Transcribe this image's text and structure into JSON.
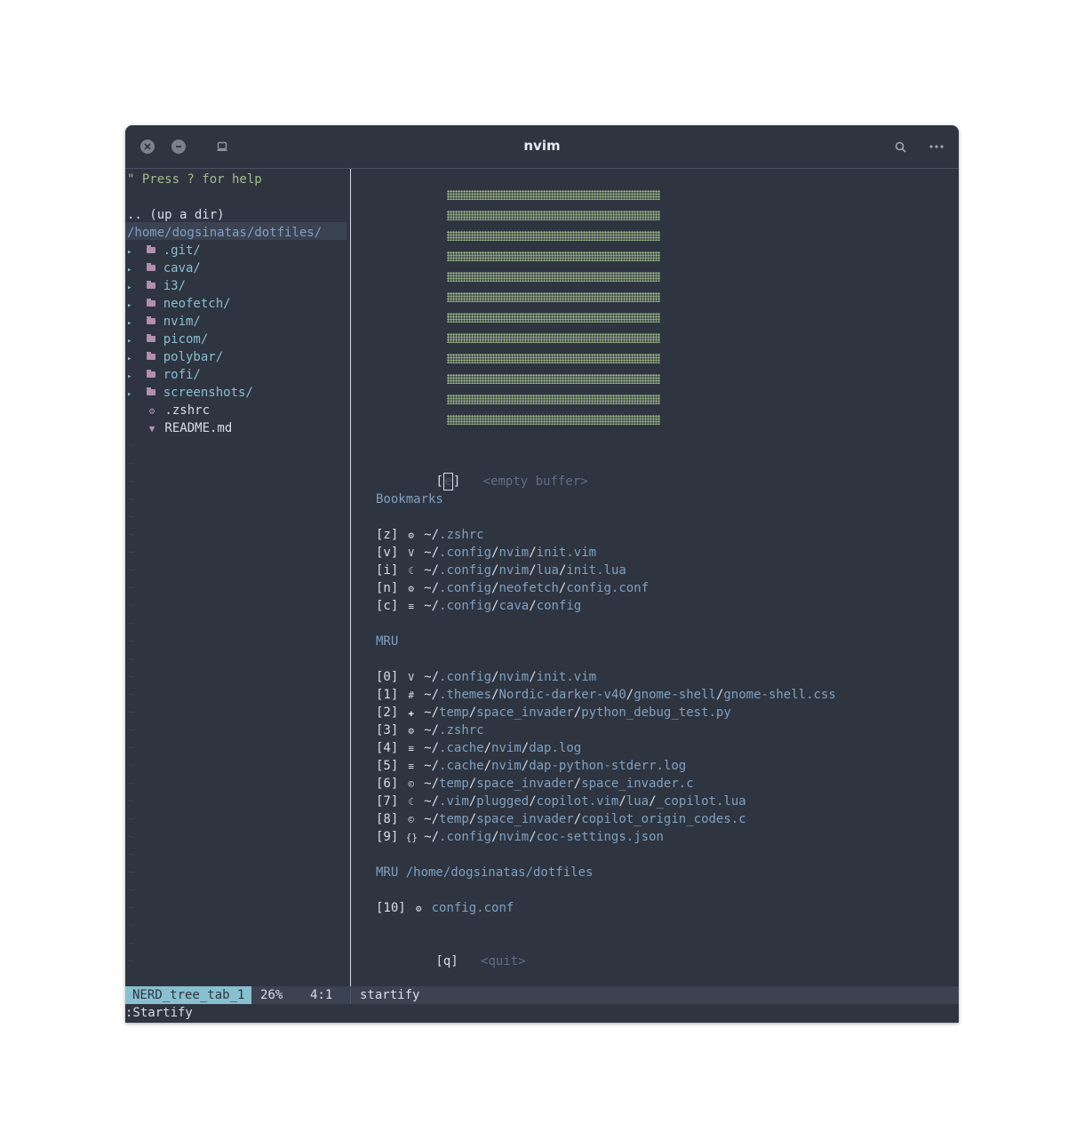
{
  "window": {
    "title": "nvim"
  },
  "tree": {
    "help": "\" Press ? for help",
    "up": ".. (up a dir)",
    "root": "/home/dogsinatas/dotfiles/",
    "folders": [
      ".git/",
      "cava/",
      "i3/",
      "neofetch/",
      "nvim/",
      "picom/",
      "polybar/",
      "rofi/",
      "screenshots/"
    ],
    "files": [
      {
        "name": ".zshrc",
        "icon": "gear-icon"
      },
      {
        "name": "README.md",
        "icon": "markdown-icon"
      }
    ]
  },
  "startify": {
    "empty_key": "e",
    "empty_label": "<empty buffer>",
    "bookmarks_header": "Bookmarks",
    "bookmarks": [
      {
        "key": "[z]",
        "icon": "gear-icon",
        "parts": [
          "~/",
          ".zshrc"
        ]
      },
      {
        "key": "[v]",
        "icon": "vim-icon",
        "parts": [
          "~/",
          ".config",
          "/",
          "nvim",
          "/",
          "init.vim"
        ]
      },
      {
        "key": "[i]",
        "icon": "lua-icon",
        "parts": [
          "~/",
          ".config",
          "/",
          "nvim",
          "/",
          "lua",
          "/",
          "init.lua"
        ]
      },
      {
        "key": "[n]",
        "icon": "gear-icon",
        "parts": [
          "~/",
          ".config",
          "/",
          "neofetch",
          "/",
          "config.conf"
        ]
      },
      {
        "key": "[c]",
        "icon": "text-icon",
        "parts": [
          "~/",
          ".config",
          "/",
          "cava",
          "/",
          "config"
        ]
      }
    ],
    "mru_header": "MRU",
    "mru": [
      {
        "key": "[0]",
        "icon": "vim-icon",
        "parts": [
          "~/",
          ".config",
          "/",
          "nvim",
          "/",
          "init.vim"
        ]
      },
      {
        "key": "[1]",
        "icon": "css-icon",
        "parts": [
          "~/",
          ".themes",
          "/",
          "Nordic-darker-v40",
          "/",
          "gnome-shell",
          "/",
          "gnome-shell.css"
        ]
      },
      {
        "key": "[2]",
        "icon": "python-icon",
        "parts": [
          "~/",
          "temp",
          "/",
          "space_invader",
          "/",
          "python_debug_test.py"
        ]
      },
      {
        "key": "[3]",
        "icon": "gear-icon",
        "parts": [
          "~/",
          ".zshrc"
        ]
      },
      {
        "key": "[4]",
        "icon": "text-icon",
        "parts": [
          "~/",
          ".cache",
          "/",
          "nvim",
          "/",
          "dap.log"
        ]
      },
      {
        "key": "[5]",
        "icon": "text-icon",
        "parts": [
          "~/",
          ".cache",
          "/",
          "nvim",
          "/",
          "dap-python-stderr.log"
        ]
      },
      {
        "key": "[6]",
        "icon": "c-icon",
        "parts": [
          "~/",
          "temp",
          "/",
          "space_invader",
          "/",
          "space_invader.c"
        ]
      },
      {
        "key": "[7]",
        "icon": "lua-icon",
        "parts": [
          "~/",
          ".vim",
          "/",
          "plugged",
          "/",
          "copilot.vim",
          "/",
          "lua",
          "/",
          "_copilot.lua"
        ]
      },
      {
        "key": "[8]",
        "icon": "c-icon",
        "parts": [
          "~/",
          "temp",
          "/",
          "space_invader",
          "/",
          "copilot_origin_codes.c"
        ]
      },
      {
        "key": "[9]",
        "icon": "json-icon",
        "parts": [
          "~/",
          ".config",
          "/",
          "nvim",
          "/",
          "coc-settings.json"
        ]
      }
    ],
    "mru_dir_header": "MRU /home/dogsinatas/dotfiles",
    "mru_dir": [
      {
        "key": "[10]",
        "icon": "gear-icon",
        "parts": [
          "config.conf"
        ]
      }
    ],
    "quit_key": "[q]",
    "quit_label": "<quit>"
  },
  "status": {
    "tree_name": "NERD_tree_tab_1",
    "percent": "26%",
    "position": "4:1",
    "buffer": "startify"
  },
  "cmdline": ":Startify",
  "icons": {
    "gear-icon": "⚙",
    "vim-icon": "V",
    "lua-icon": "☾",
    "text-icon": "≡",
    "css-icon": "#",
    "python-icon": "✚",
    "c-icon": "©",
    "json-icon": "{}",
    "markdown-icon": "▼"
  },
  "colors": {
    "bg": "#2e3440",
    "accent": "#88c0d0",
    "path": "#81a1c1",
    "art": "#a3be8c"
  }
}
